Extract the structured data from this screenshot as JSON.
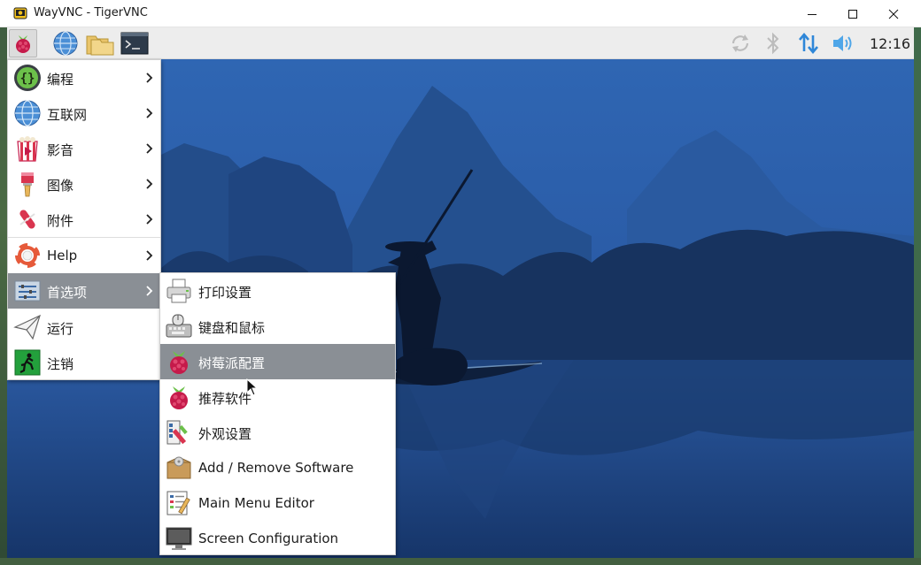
{
  "window": {
    "title": "WayVNC - TigerVNC",
    "controls": {
      "minimize": "minimize",
      "maximize": "maximize",
      "close": "close"
    }
  },
  "panel": {
    "launchers": [
      "raspberry-menu-icon",
      "web-browser-icon",
      "file-manager-icon",
      "terminal-icon"
    ],
    "tray": [
      "sync-icon",
      "bluetooth-icon",
      "network-icon",
      "volume-icon"
    ],
    "clock": "12:16"
  },
  "main_menu": {
    "items": [
      {
        "label": "编程",
        "icon": "programming-icon",
        "has_submenu": true
      },
      {
        "label": "互联网",
        "icon": "internet-icon",
        "has_submenu": true
      },
      {
        "label": "影音",
        "icon": "sound-video-icon",
        "has_submenu": true
      },
      {
        "label": "图像",
        "icon": "graphics-icon",
        "has_submenu": true
      },
      {
        "label": "附件",
        "icon": "accessories-icon",
        "has_submenu": true
      },
      {
        "label": "Help",
        "icon": "help-icon",
        "has_submenu": true
      },
      {
        "label": "首选项",
        "icon": "preferences-icon",
        "has_submenu": true,
        "active": true
      },
      {
        "label": "运行",
        "icon": "run-icon",
        "has_submenu": false
      },
      {
        "label": "注销",
        "icon": "logout-icon",
        "has_submenu": false
      }
    ]
  },
  "sub_menu": {
    "items": [
      {
        "label": "打印设置",
        "icon": "printer-icon"
      },
      {
        "label": "键盘和鼠标",
        "icon": "keyboard-mouse-icon"
      },
      {
        "label": "树莓派配置",
        "icon": "raspberry-config-icon",
        "active": true
      },
      {
        "label": "推荐软件",
        "icon": "recommended-software-icon"
      },
      {
        "label": "外观设置",
        "icon": "appearance-icon"
      },
      {
        "label": "Add / Remove Software",
        "icon": "package-icon"
      },
      {
        "label": "Main Menu Editor",
        "icon": "menu-editor-icon"
      },
      {
        "label": "Screen Configuration",
        "icon": "monitor-icon"
      }
    ]
  },
  "colors": {
    "menu_highlight": "#8a8f95",
    "panel_bg": "#ededed",
    "wallpaper_sky": "#1e4f96",
    "raspberry_red": "#c51a4a",
    "raspberry_leaf": "#6cc04a"
  }
}
